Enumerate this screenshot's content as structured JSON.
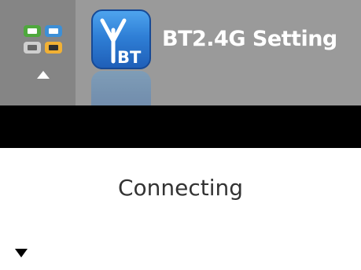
{
  "header": {
    "title": "BT2.4G Setting",
    "app_icon": {
      "name": "bluetooth-antenna-icon",
      "label": "BT",
      "color": "#2f7fd6"
    },
    "menu_icons": [
      "display-icon",
      "hdmi-icon",
      "usb-drive-icon",
      "vga-icon"
    ],
    "background_color": "#9a9a9a"
  },
  "main": {
    "status_text": "Connecting"
  },
  "navigation": {
    "up_icon": "up-arrow-icon",
    "down_icon": "down-arrow-icon"
  }
}
